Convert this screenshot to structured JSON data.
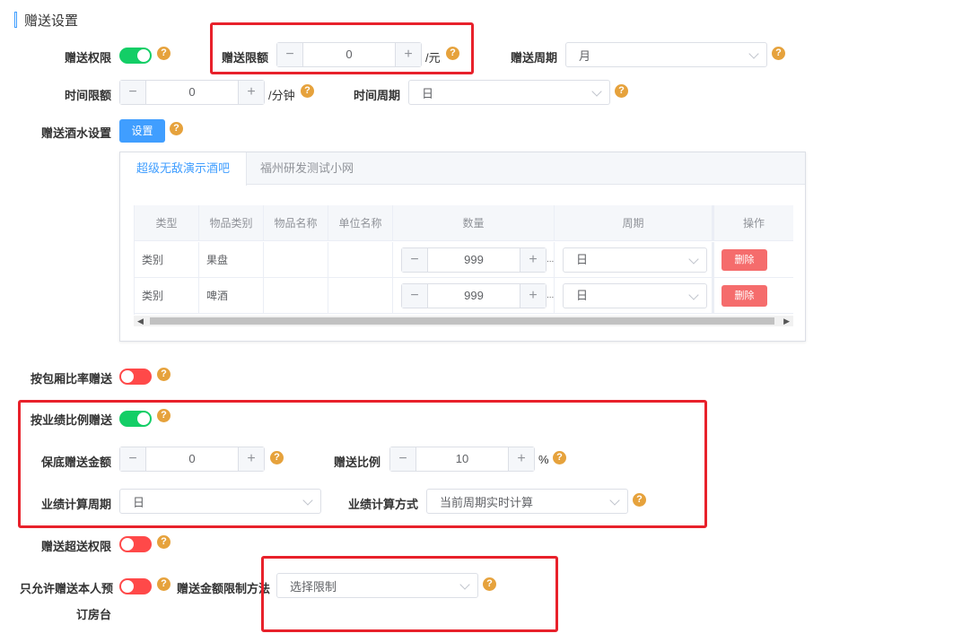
{
  "section_title": "赠送设置",
  "gift_permission": {
    "label": "赠送权限",
    "on": true
  },
  "gift_limit": {
    "label": "赠送限额",
    "value": "0",
    "unit": "/元",
    "minus": "−",
    "plus": "+"
  },
  "gift_period": {
    "label": "赠送周期",
    "value": "月"
  },
  "time_limit": {
    "label": "时间限额",
    "value": "0",
    "unit": "/分钟",
    "minus": "−",
    "plus": "+"
  },
  "time_period": {
    "label": "时间周期",
    "value": "日"
  },
  "wine_setting": {
    "label": "赠送酒水设置",
    "button": "设置"
  },
  "tabs": [
    "超级无敌演示酒吧",
    "福州研发测试小网"
  ],
  "table": {
    "columns": [
      "类型",
      "物品类别",
      "物品名称",
      "单位名称",
      "数量",
      "周期",
      "操作"
    ],
    "rows": [
      {
        "type": "类别",
        "category": "果盘",
        "name": "",
        "unit": "",
        "qty": "999",
        "period": "日",
        "action": "删除"
      },
      {
        "type": "类别",
        "category": "啤酒",
        "name": "",
        "unit": "",
        "qty": "999",
        "period": "日",
        "action": "删除"
      }
    ],
    "ellipsis": "..."
  },
  "room_ratio": {
    "label": "按包厢比率赠送",
    "on": false
  },
  "perf_ratio": {
    "label": "按业绩比例赠送",
    "on": true
  },
  "min_amount": {
    "label": "保底赠送金额",
    "value": "0"
  },
  "gift_ratio": {
    "label": "赠送比例",
    "value": "10",
    "unit": "%"
  },
  "perf_period": {
    "label": "业绩计算周期",
    "value": "日"
  },
  "perf_method": {
    "label": "业绩计算方式",
    "value": "当前周期实时计算"
  },
  "over_permission": {
    "label": "赠送超送权限",
    "on": false
  },
  "own_room_only": {
    "label_line1": "只允许赠送本人预",
    "label_line2": "订房台",
    "on": false
  },
  "amount_limit_method": {
    "label": "赠送金额限制方法",
    "placeholder": "选择限制"
  },
  "help_glyph": "?",
  "colors": {
    "switch_on": "#13ce66",
    "switch_off": "#ff4949",
    "primary": "#409eff",
    "danger": "#f56c6c",
    "help": "#e6a23c",
    "highlight": "#e8212b"
  }
}
